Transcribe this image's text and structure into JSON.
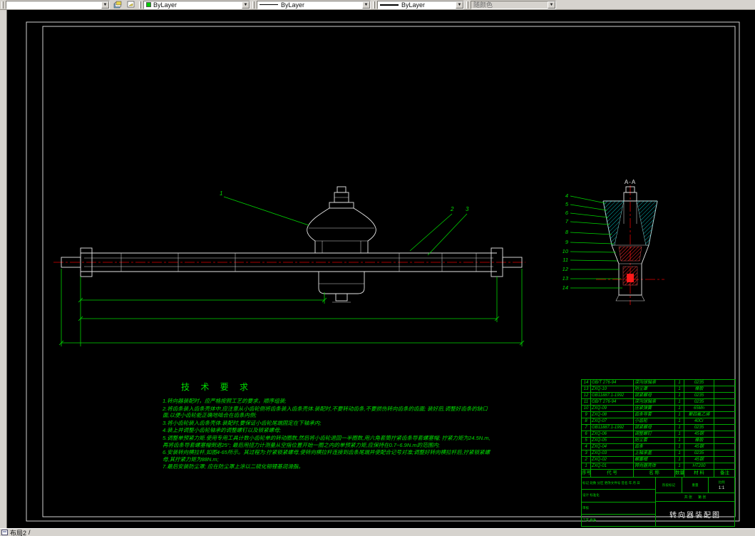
{
  "toolbar": {
    "color_value": "ByLayer",
    "color_swatch": "#00cc00",
    "linetype_value": "ByLayer",
    "lineweight_value": "ByLayer",
    "plotstyle_value": "随颜色",
    "arrow_glyph": "▼"
  },
  "statusbar": {
    "layout_tab": "布局2",
    "separator": "/"
  },
  "drawing": {
    "section_title": "A-A",
    "main_callouts": [
      "1",
      "2",
      "3"
    ],
    "section_callouts": [
      "4",
      "5",
      "6",
      "7",
      "8",
      "9",
      "10",
      "11",
      "12",
      "13",
      "14"
    ],
    "tech": {
      "title": "技 术 要 求",
      "lines": [
        "1.转向器装配时，应严格按照工艺的要求，顺序组装;",
        "2.将齿条装入齿条壳体中,应注意从小齿轮侧将齿条装入齿条壳体.装配时,不要转动齿条,不要损伤转向齿条的齿面; 装好后,调整好齿条的缺口面,以便小齿轮能正确地啮合在齿条内侧;",
        "3.将小齿轮装入齿条壳体.装配时,要保证小齿轮尾端固定在下轴承内;",
        "4.装上并调整小齿轮轴承的调整螺钉以及锁紧螺母;",
        "5.调整单预紧力矩.使用专用工具计数小齿轮单的转动圈数,然后将小齿轮退回一半圈数,用六角套筒拧紧齿条导套螺塞帽; 拧紧力矩为24.5N.m,再将齿条导套螺塞帽倒退25°; 最后用扭力计测量从空指位置开始一圈之内的单预紧力矩,应保持在0.7~6.9N.m的范围内;",
        "6.安装转向横拉杆,如图4-65所示。其过程为:拧紧锁紧螺母,使转向横拉杆连接到齿条尾端并使配合记号对准;调整好转向横拉杆后,拧紧锁紧螺母,其拧紧力矩为88N.m;",
        "7.最后安装防尘罩; 应在防尘罩上涂以二硫化钼锂基润滑脂。"
      ]
    }
  },
  "bom": {
    "headers": [
      "序号",
      "代 号",
      "名 称",
      "数量",
      "材 料",
      "备注"
    ],
    "rows": [
      {
        "idx": "14",
        "code": "GB/T 276-94",
        "name": "深沟球轴承",
        "qty": "1",
        "material": "0235",
        "note": ""
      },
      {
        "idx": "13",
        "code": "ZXQ-10",
        "name": "防尘罩",
        "qty": "1",
        "material": "橡胶",
        "note": ""
      },
      {
        "idx": "12",
        "code": "GB11887.1-1992",
        "name": "锁紧螺母",
        "qty": "1",
        "material": "0235",
        "note": ""
      },
      {
        "idx": "11",
        "code": "GB/T 276-94",
        "name": "深沟球轴承",
        "qty": "1",
        "material": "0235",
        "note": ""
      },
      {
        "idx": "10",
        "code": "ZXQ-09",
        "name": "压紧弹簧",
        "qty": "1",
        "material": "65Mn",
        "note": ""
      },
      {
        "idx": "9",
        "code": "ZXQ-08",
        "name": "齿条导套",
        "qty": "1",
        "material": "聚四氟乙烯",
        "note": ""
      },
      {
        "idx": "8",
        "code": "ZXQ-07",
        "name": "小齿轮",
        "qty": "1",
        "material": "40Cr",
        "note": ""
      },
      {
        "idx": "7",
        "code": "GB11887.1-1992",
        "name": "锁紧螺母",
        "qty": "1",
        "material": "0235",
        "note": ""
      },
      {
        "idx": "6",
        "code": "ZXQ-06",
        "name": "调整螺钉",
        "qty": "1",
        "material": "45钢",
        "note": ""
      },
      {
        "idx": "5",
        "code": "ZXQ-05",
        "name": "防尘套",
        "qty": "1",
        "material": "橡胶",
        "note": ""
      },
      {
        "idx": "4",
        "code": "ZXQ-04",
        "name": "齿条",
        "qty": "1",
        "material": "45钢",
        "note": ""
      },
      {
        "idx": "3",
        "code": "ZXQ-03",
        "name": "上轴承盖",
        "qty": "1",
        "material": "0235",
        "note": ""
      },
      {
        "idx": "2",
        "code": "ZXQ-02",
        "name": "螺塞帽",
        "qty": "1",
        "material": "45钢",
        "note": ""
      },
      {
        "idx": "1",
        "code": "ZXQ-01",
        "name": "转向器壳体",
        "qty": "1",
        "material": "HT200",
        "note": ""
      }
    ]
  },
  "titleblock": {
    "title": "转向器装配图",
    "stage_label": "阶段标记",
    "weight_label": "重量",
    "scale_label": "比例",
    "scale": "1:1",
    "sheet_total": "共 张",
    "sheet_no": "第 张",
    "rows_left": [
      "标记 处数 分区 更改文件号 签名 年.月.日",
      "设计          标准化",
      "审核",
      "工艺          批准"
    ]
  }
}
